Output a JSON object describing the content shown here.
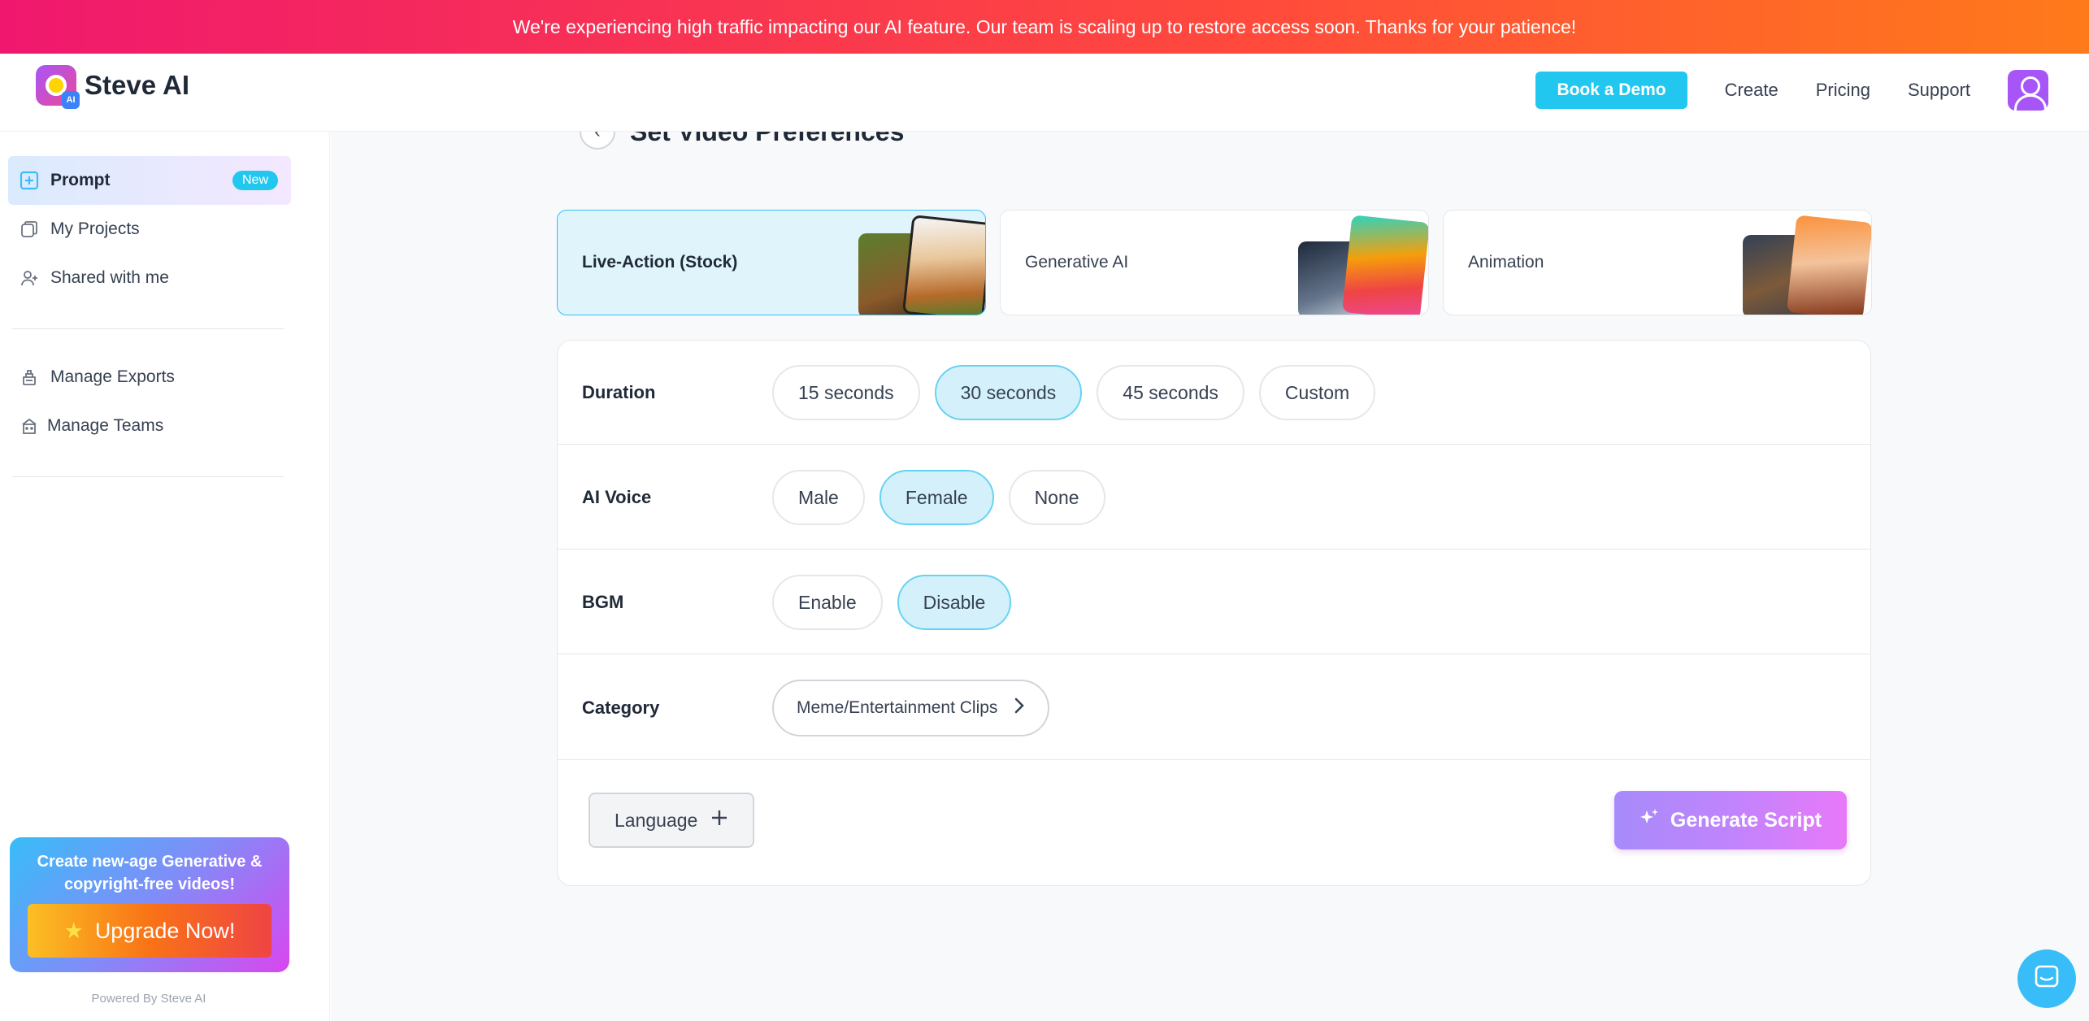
{
  "banner": {
    "text": "We're experiencing high traffic impacting our AI feature. Our team is scaling up to restore access soon. Thanks for your patience!"
  },
  "header": {
    "logo_text": "Steve AI",
    "logo_badge": "AI",
    "book_demo": "Book a Demo",
    "nav": [
      "Create",
      "Pricing",
      "Support"
    ]
  },
  "sidebar": {
    "items": [
      {
        "label": "Prompt",
        "icon": "plus-square-icon",
        "badge": "New",
        "active": true
      },
      {
        "label": "My Projects",
        "icon": "projects-icon"
      },
      {
        "label": "Shared with me",
        "icon": "user-share-icon"
      },
      {
        "label": "Manage Exports",
        "icon": "export-icon"
      },
      {
        "label": "Manage Teams",
        "icon": "team-icon"
      }
    ],
    "promo": {
      "text": "Create new-age Generative & copyright-free videos!",
      "button": "Upgrade Now!"
    },
    "powered_by": "Powered By Steve AI"
  },
  "main": {
    "title": "Set Video Preferences",
    "video_types": [
      {
        "label": "Live-Action (Stock)",
        "selected": true
      },
      {
        "label": "Generative AI",
        "selected": false
      },
      {
        "label": "Animation",
        "selected": false
      }
    ],
    "preferences": {
      "duration": {
        "label": "Duration",
        "options": [
          "15 seconds",
          "30 seconds",
          "45 seconds",
          "Custom"
        ],
        "selected": "30 seconds"
      },
      "voice": {
        "label": "AI Voice",
        "options": [
          "Male",
          "Female",
          "None"
        ],
        "selected": "Female"
      },
      "bgm": {
        "label": "BGM",
        "options": [
          "Enable",
          "Disable"
        ],
        "selected": "Disable"
      },
      "category": {
        "label": "Category",
        "value": "Meme/Entertainment Clips"
      }
    },
    "language_button": "Language",
    "generate_button": "Generate Script"
  },
  "colors": {
    "accent": "#22c7f0",
    "selected_bg": "#d4f1fb",
    "generate": "#c084fc"
  }
}
